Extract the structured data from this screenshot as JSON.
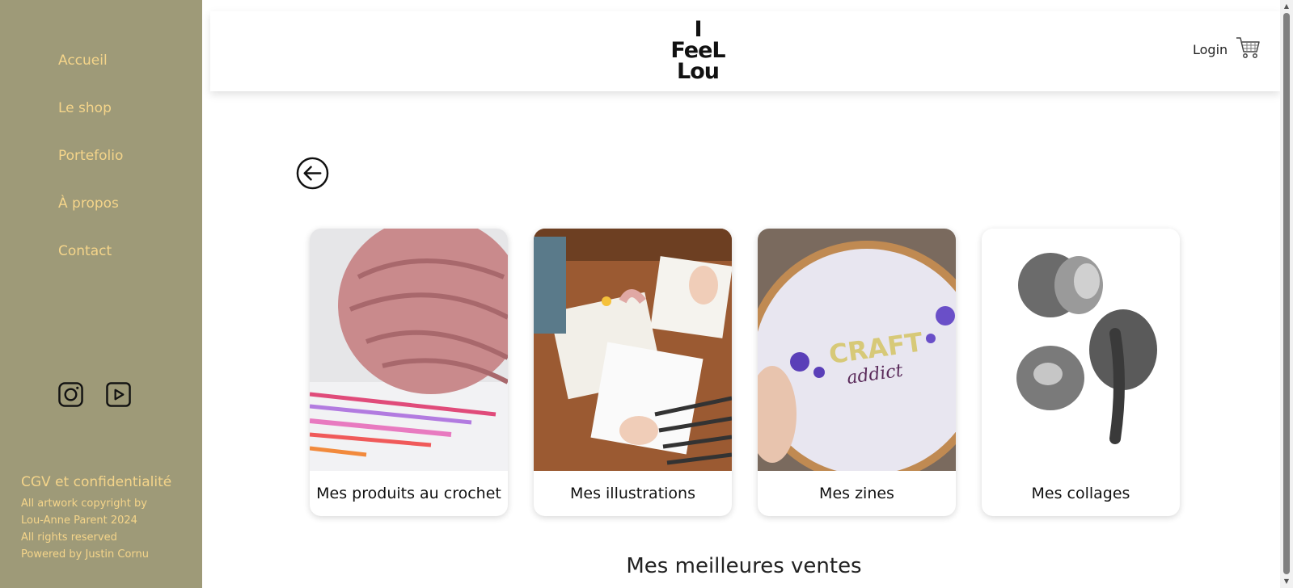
{
  "sidebar": {
    "nav": [
      {
        "label": "Accueil"
      },
      {
        "label": "Le shop"
      },
      {
        "label": "Portefolio"
      },
      {
        "label": "À propos"
      },
      {
        "label": "Contact"
      }
    ],
    "socials": [
      {
        "icon": "instagram-icon"
      },
      {
        "icon": "youtube-icon"
      }
    ],
    "footer": {
      "cgv": "CGV et confidentialité",
      "lines": [
        "All artwork copyright by",
        "Lou-Anne Parent 2024",
        "All rights reserved",
        "Powered by Justin Cornu"
      ]
    },
    "colors": {
      "background": "#9e9a78",
      "text": "#f5d58a"
    }
  },
  "header": {
    "logo_lines": [
      "I",
      "FeeL",
      "Lou"
    ],
    "login": "Login",
    "cart_icon": "cart-icon"
  },
  "main": {
    "back_icon": "arrow-left-circle-icon",
    "categories": [
      {
        "label": "Mes produits au crochet",
        "image": "pink yarn ball with crochet hooks"
      },
      {
        "label": "Mes illustrations",
        "image": "hands drawing at wooden table with pencils"
      },
      {
        "label": "Mes zines",
        "image": "embroidery hoop with CRAFT addict text"
      },
      {
        "label": "Mes collages",
        "image": "black and white frog collage"
      }
    ],
    "section_title": "Mes meilleures ventes"
  }
}
